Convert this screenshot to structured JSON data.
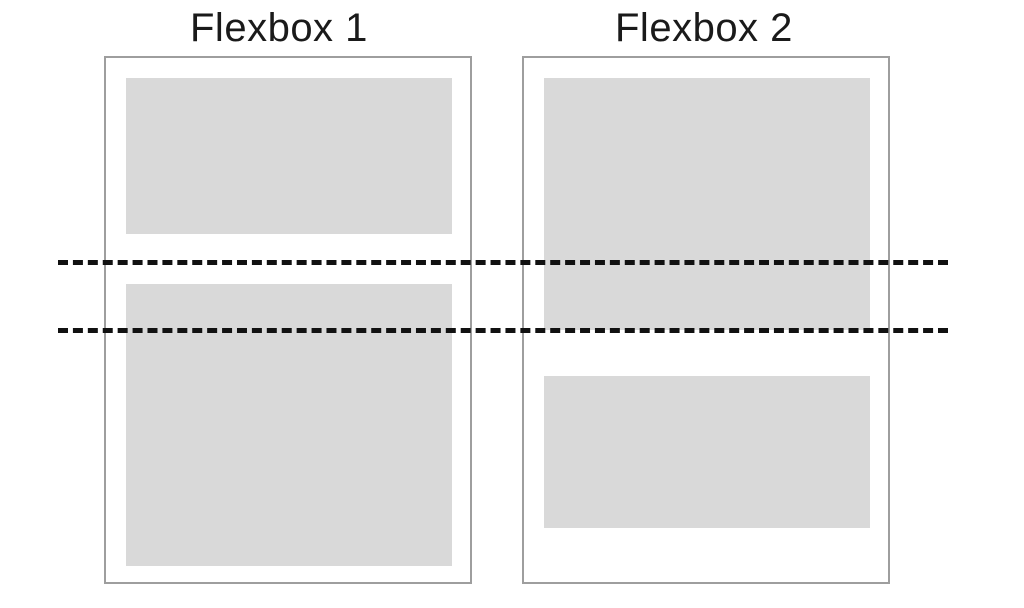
{
  "titles": {
    "left": "Flexbox 1",
    "right": "Flexbox 2"
  },
  "diagram": {
    "description": "Two side-by-side flexbox column containers, each with two grey items of different heights. Two horizontal dashed guide lines cross both containers showing that the item boundaries do not align between the two flexboxes.",
    "dash_lines": 2,
    "flexboxes": [
      {
        "name": "Flexbox 1",
        "items": 2
      },
      {
        "name": "Flexbox 2",
        "items": 2
      }
    ]
  }
}
